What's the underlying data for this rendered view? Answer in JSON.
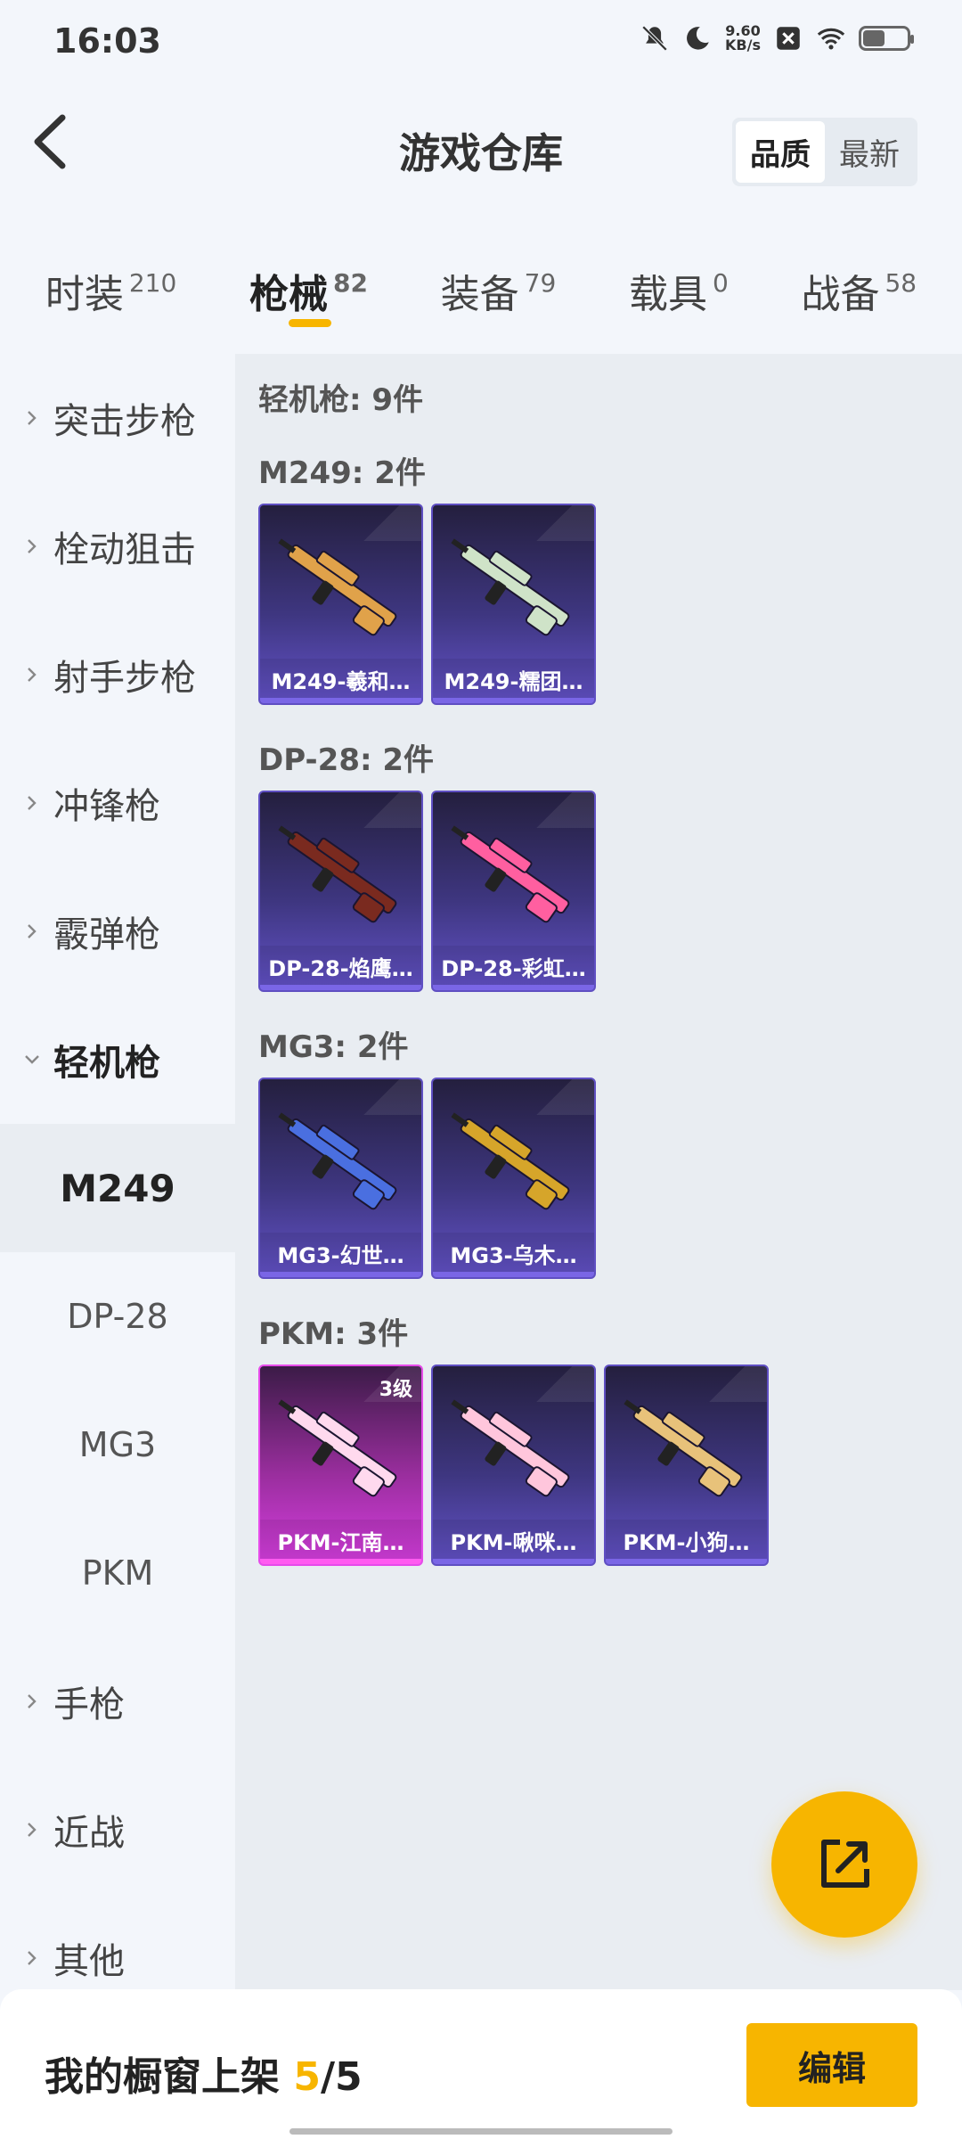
{
  "status_bar": {
    "time": "16:03",
    "net_speed": "9.60",
    "net_unit": "KB/s"
  },
  "header": {
    "title": "游戏仓库",
    "sort_options": [
      "品质",
      "最新"
    ],
    "sort_active": "品质"
  },
  "tabs": [
    {
      "label": "时装",
      "count": "210"
    },
    {
      "label": "枪械",
      "count": "82"
    },
    {
      "label": "装备",
      "count": "79"
    },
    {
      "label": "载具",
      "count": "0"
    },
    {
      "label": "战备",
      "count": "58"
    }
  ],
  "sidebar": {
    "categories_top": [
      "突击步枪",
      "栓动狙击",
      "射手步枪",
      "冲锋枪",
      "霰弹枪"
    ],
    "open_category": "轻机枪",
    "subitems": [
      "M249",
      "DP-28",
      "MG3",
      "PKM"
    ],
    "active_subitem": "M249",
    "categories_bottom": [
      "手枪",
      "近战",
      "其他"
    ]
  },
  "content": {
    "section_title": "轻机枪: 9件",
    "groups": [
      {
        "title": "M249: 2件",
        "items": [
          {
            "label": "M249-羲和…",
            "rarity": "purple",
            "color": "#e0a24a"
          },
          {
            "label": "M249-糯团…",
            "rarity": "purple",
            "color": "#cfe3c8"
          }
        ]
      },
      {
        "title": "DP-28: 2件",
        "items": [
          {
            "label": "DP-28-焰鹰…",
            "rarity": "purple",
            "color": "#7a2a1f"
          },
          {
            "label": "DP-28-彩虹…",
            "rarity": "purple",
            "color": "#ff5fa0"
          }
        ]
      },
      {
        "title": "MG3: 2件",
        "items": [
          {
            "label": "MG3-幻世…",
            "rarity": "purple",
            "color": "#4a6fe0"
          },
          {
            "label": "MG3-乌木…",
            "rarity": "purple",
            "color": "#d6a52a"
          }
        ]
      },
      {
        "title": "PKM: 3件",
        "items": [
          {
            "label": "PKM-江南…",
            "rarity": "pink",
            "level": "3级",
            "color": "#ffd9ee"
          },
          {
            "label": "PKM-啾咪…",
            "rarity": "purple",
            "color": "#ffc6dc"
          },
          {
            "label": "PKM-小狗…",
            "rarity": "purple",
            "color": "#e8c27a"
          }
        ]
      }
    ]
  },
  "bottom_bar": {
    "text": "我的橱窗上架 ",
    "count": "5",
    "total": "/5",
    "edit_label": "编辑"
  }
}
